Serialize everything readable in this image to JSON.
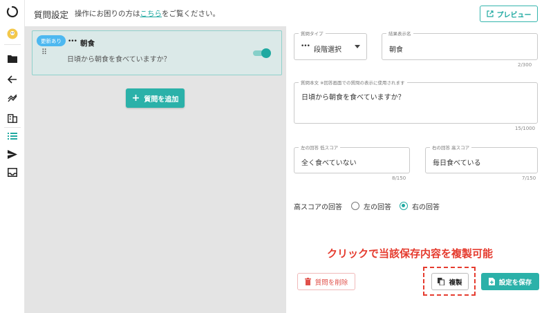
{
  "header": {
    "title": "質問設定",
    "help_prefix": "操作にお困りの方は",
    "help_link": "こちら",
    "help_suffix": "をご覧ください。",
    "preview_label": "プレビュー"
  },
  "question_list": {
    "items": [
      {
        "badge": "更新あり",
        "type_glyph": "•••",
        "name": "朝食",
        "text": "日頃から朝食を食べていますか？",
        "enabled": true
      }
    ],
    "add_label": "質問を追加"
  },
  "form": {
    "question_type": {
      "label": "質問タイプ",
      "glyph": "•••",
      "value": "段階選択"
    },
    "result_name": {
      "label": "結果表示名",
      "value": "朝食",
      "counter": "2/300"
    },
    "question_body": {
      "label": "質問本文 ※回答画面での質問の表示に使用されます",
      "value": "日頃から朝食を食べていますか？",
      "counter": "15/1000"
    },
    "left_answer": {
      "label": "左の回答 低スコア",
      "value": "全く食べていない",
      "counter": "8/150"
    },
    "right_answer": {
      "label": "右の回答 高スコア",
      "value": "毎日食べている",
      "counter": "7/150"
    },
    "high_score": {
      "label": "高スコアの回答",
      "options": [
        "左の回答",
        "右の回答"
      ],
      "selected": "右の回答"
    }
  },
  "annotation": "クリックで当該保存内容を複製可能",
  "actions": {
    "delete_label": "質問を削除",
    "duplicate_label": "複製",
    "save_label": "設定を保存"
  },
  "colors": {
    "accent": "#2bb1a9",
    "badge": "#4db8f0",
    "annotation": "#e53b2e",
    "danger": "#e0504a"
  }
}
